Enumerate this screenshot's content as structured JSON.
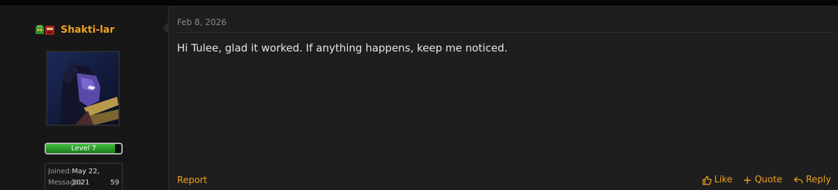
{
  "post": {
    "username": "Shakti-lar",
    "level": {
      "label": "Level 7",
      "progress": 0.92
    },
    "user_info": {
      "joined_label": "Joined:",
      "joined_value": "May 22, 2021",
      "messages_label": "Messages:",
      "messages_value": "59"
    },
    "date": "Feb 8, 2026",
    "body": "Hi Tulee, glad it worked. If anything happens, keep me noticed.",
    "actions": {
      "report": "Report",
      "like": "Like",
      "quote": "Quote",
      "reply": "Reply"
    },
    "colors": {
      "accent": "#f0a020",
      "level_bar": "#2e9e2e",
      "background": "#1e1e1e"
    },
    "icons": [
      "rank-emblem-icon",
      "like-icon",
      "quote-icon",
      "reply-icon"
    ]
  }
}
